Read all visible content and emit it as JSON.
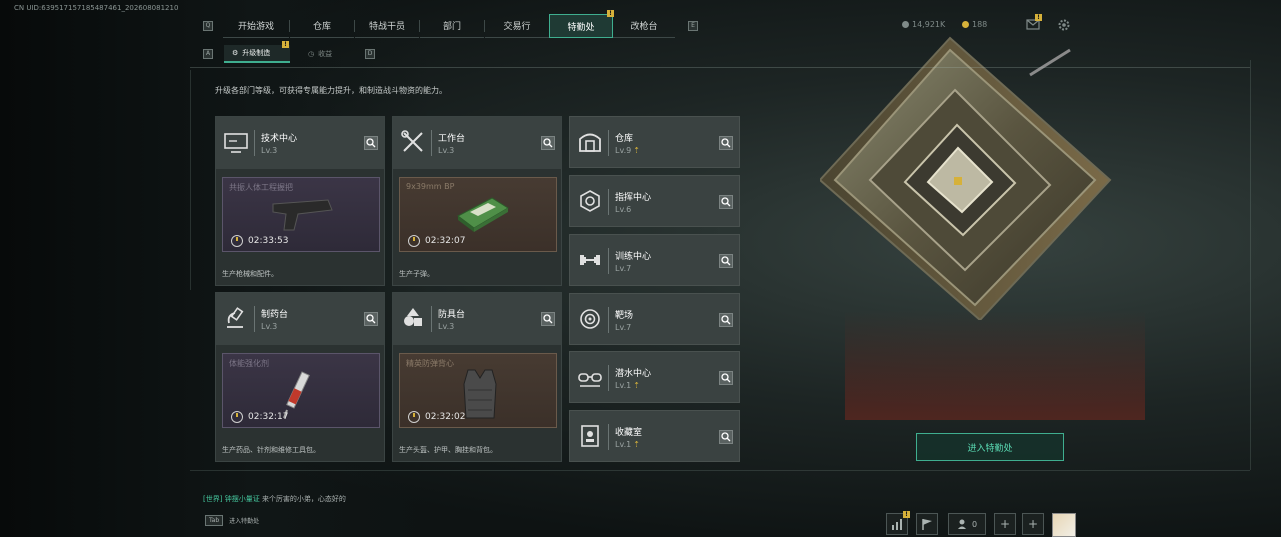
{
  "uid": "CN UID:639517157185487461_202608081210",
  "topnav": {
    "tabs": [
      {
        "label": "开始游戏"
      },
      {
        "label": "仓库"
      },
      {
        "label": "特战干员"
      },
      {
        "label": "部门"
      },
      {
        "label": "交易行"
      },
      {
        "label": "特勤处",
        "active": true,
        "badge": "!"
      },
      {
        "label": "改枪台"
      }
    ],
    "left_key": "Q",
    "right_key": "E"
  },
  "currency": {
    "money": "14,921K",
    "coins": "188"
  },
  "subtabs": [
    {
      "label": "升级制造",
      "active": true,
      "badge": "!"
    },
    {
      "label": "收益",
      "active": false
    }
  ],
  "subtab_left_key": "A",
  "subtab_right_key": "D",
  "description": "升级各部门等级，可获得专属能力提升，和制造战斗物资的能力。",
  "production_cards": [
    {
      "name": "技术中心",
      "level": "Lv.3",
      "icon": "monitor-icon",
      "product": "共振人体工程握把",
      "timer": "02:33:53",
      "footer": "生产枪械和配件。",
      "theme": "purple"
    },
    {
      "name": "工作台",
      "level": "Lv.3",
      "icon": "tools-icon",
      "product": "9x39mm BP",
      "timer": "02:32:07",
      "footer": "生产子弹。",
      "theme": "brown"
    },
    {
      "name": "制药台",
      "level": "Lv.3",
      "icon": "microscope-icon",
      "product": "体能强化剂",
      "timer": "02:32:17",
      "footer": "生产药品、针剂和维修工具包。",
      "theme": "purple"
    },
    {
      "name": "防具台",
      "level": "Lv.3",
      "icon": "materials-icon",
      "product": "精英防弹背心",
      "timer": "02:32:02",
      "footer": "生产头盔、护甲、胸挂和背包。",
      "theme": "brown"
    }
  ],
  "facility_cards": [
    {
      "name": "仓库",
      "level": "Lv.9",
      "icon": "vault-icon",
      "upgrade": true
    },
    {
      "name": "指挥中心",
      "level": "Lv.6",
      "icon": "chip-icon",
      "upgrade": false
    },
    {
      "name": "训练中心",
      "level": "Lv.7",
      "icon": "dumbbell-icon",
      "upgrade": false
    },
    {
      "name": "靶场",
      "level": "Lv.7",
      "icon": "target-icon",
      "upgrade": false
    },
    {
      "name": "潜水中心",
      "level": "Lv.1",
      "icon": "goggles-icon",
      "upgrade": true
    },
    {
      "name": "收藏室",
      "level": "Lv.1",
      "icon": "collection-icon",
      "upgrade": true
    }
  ],
  "enter_button": "进入特勤处",
  "chat": {
    "channel": "[世界]",
    "user": "钟摆小量证",
    "message": "来个厉害的小弟，心态好的"
  },
  "tab_hint": {
    "key": "Tab",
    "label": "进入特勤处"
  },
  "bottom_bar": {
    "friends_count": "0",
    "badge": "!"
  },
  "accent_color": "#3fae8f",
  "gold_color": "#d6b13a"
}
